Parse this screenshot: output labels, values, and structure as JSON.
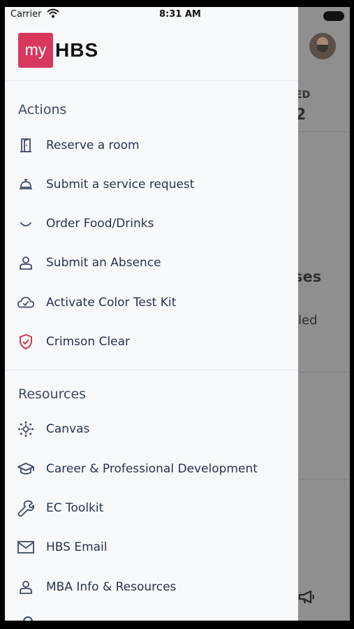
{
  "status_bar": {
    "carrier": "Carrier",
    "time": "8:31 AM"
  },
  "logo": {
    "my": "my",
    "hbs": "HBS"
  },
  "background": {
    "partial_1": "ED",
    "partial_2": "2",
    "partial_3": "ses",
    "partial_4": "led"
  },
  "actions": {
    "title": "Actions",
    "items": [
      {
        "label": "Reserve a room",
        "icon": "door-icon"
      },
      {
        "label": "Submit a service request",
        "icon": "service-bell-icon"
      },
      {
        "label": "Order Food/Drinks",
        "icon": "smile-icon"
      },
      {
        "label": "Submit an Absence",
        "icon": "person-icon"
      },
      {
        "label": "Activate Color Test Kit",
        "icon": "cloud-check-icon"
      },
      {
        "label": "Crimson Clear",
        "icon": "shield-check-icon"
      }
    ]
  },
  "resources": {
    "title": "Resources",
    "items": [
      {
        "label": "Canvas",
        "icon": "canvas-icon"
      },
      {
        "label": "Career & Professional Development",
        "icon": "graduation-cap-icon"
      },
      {
        "label": "EC Toolkit",
        "icon": "wrench-icon"
      },
      {
        "label": "HBS Email",
        "icon": "envelope-icon"
      },
      {
        "label": "MBA Info & Resources",
        "icon": "person-icon"
      }
    ]
  },
  "colors": {
    "accent": "#d8385e",
    "text": "#26334d",
    "section": "#3c4a63",
    "drawer_bg": "#f7f8fa"
  }
}
